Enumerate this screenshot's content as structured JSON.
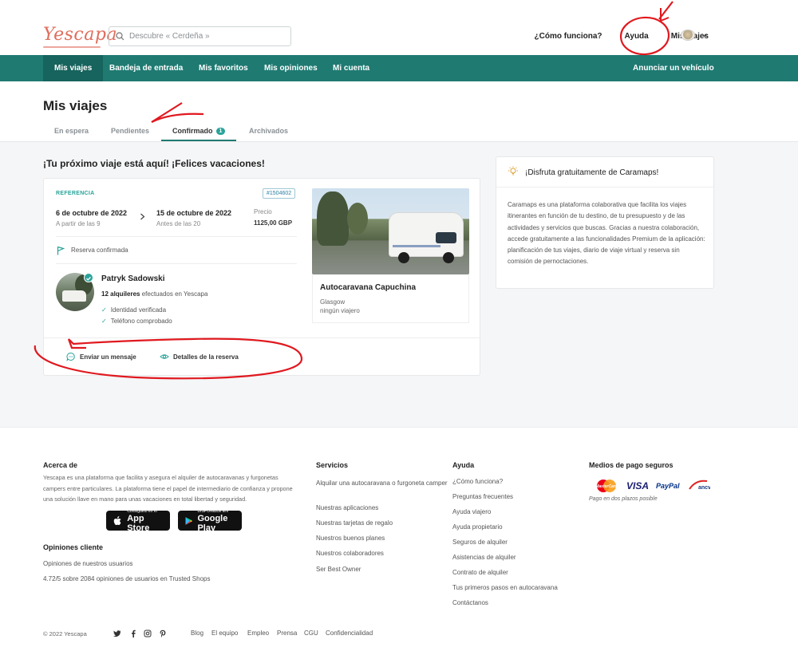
{
  "header": {
    "logo": "Yescapa",
    "search_placeholder": "Descubre « Cerdeña »",
    "links": {
      "how": "¿Cómo funciona?",
      "help": "Ayuda",
      "trips": "Mis viajes"
    }
  },
  "nav": {
    "items": [
      "Mis viajes",
      "Bandeja de entrada",
      "Mis favoritos",
      "Mis opiniones",
      "Mi cuenta"
    ],
    "right": "Anunciar un vehículo"
  },
  "page": {
    "title": "Mis viajes",
    "tabs": [
      "En espera",
      "Pendientes",
      "Confirmado",
      "Archivados"
    ],
    "confirmed_count": "1"
  },
  "trip": {
    "heading": "¡Tu próximo viaje está aquí! ¡Felices vacaciones!",
    "ref_label": "REFERENCIA",
    "ref_number": "#1504602",
    "start_date": "6 de octubre de 2022",
    "start_note": "A partir de las 9",
    "end_date": "15 de octubre de 2022",
    "end_note": "Antes de las 20",
    "price_label": "Precio",
    "price_value": "1125,00 GBP",
    "status": "Reserva confirmada",
    "owner": {
      "name": "Patryk Sadowski",
      "rentals_count": "12 alquileres",
      "rentals_suffix": " efectuados en Yescapa",
      "check1": "Identidad verificada",
      "check2": "Teléfono comprobado"
    },
    "vehicle": {
      "name": "Autocaravana Capuchina",
      "city": "Glasgow",
      "travellers": "ningún viajero"
    },
    "actions": {
      "message": "Enviar un mensaje",
      "details": "Detalles de la reserva"
    }
  },
  "promo": {
    "title": "¡Disfruta gratuitamente de Caramaps!",
    "text": "Caramaps es una plataforma colaborativa que facilita los viajes itinerantes en función de tu destino, de tu presupuesto y de las actividades y servicios que buscas. Gracias a nuestra colaboración, accede gratuitamente a las funcionalidades Premium de la aplicación: planificación de tus viajes, diario de viaje virtual y reserva sin comisión de pernoctaciones."
  },
  "footer": {
    "about": {
      "title": "Acerca de",
      "text": "Yescapa es una plataforma que facilita y asegura el alquiler de autocaravanas y furgonetas campers entre particulares. La plataforma tiene el papel de intermediario de confianza y propone una solución llave en mano para unas vacaciones en total libertad y seguridad."
    },
    "appstore": {
      "small": "Consíguelo en el",
      "big": "App Store"
    },
    "googleplay": {
      "small": "DISPONIBLE EN",
      "big": "Google Play"
    },
    "reviews": {
      "title": "Opiniones cliente",
      "link1": "Opiniones de nuestros usuarios",
      "link2": "4.72/5 sobre 2084 opiniones de usuarios en Trusted Shops"
    },
    "services": {
      "title": "Servicios",
      "items": [
        "Alquilar una autocaravana o furgoneta camper",
        "Nuestras aplicaciones",
        "Nuestras tarjetas de regalo",
        "Nuestros buenos planes",
        "Nuestros colaboradores",
        "Ser Best Owner"
      ]
    },
    "help": {
      "title": "Ayuda",
      "items": [
        "¿Cómo funciona?",
        "Preguntas frecuentes",
        "Ayuda viajero",
        "Ayuda propietario",
        "Seguros de alquiler",
        "Asistencias de alquiler",
        "Contrato de alquiler",
        "Tus primeros pasos en autocaravana",
        "Contáctanos"
      ]
    },
    "payment": {
      "title": "Medios de pago seguros",
      "mastercard": "MasterCard",
      "visa": "VISA",
      "paypal": "PayPal",
      "ancv": "ancv",
      "note": "Pago en dos plazos posible"
    },
    "copyright": "© 2022 Yescapa",
    "bottom_links": [
      "Blog",
      "El equipo",
      "Empleo",
      "Prensa",
      "CGU",
      "Confidencialidad"
    ]
  },
  "colors": {
    "brand": "#1f7a72",
    "accent": "#2aa39a",
    "logo": "#e06d5c",
    "annotation": "#e0191f"
  }
}
